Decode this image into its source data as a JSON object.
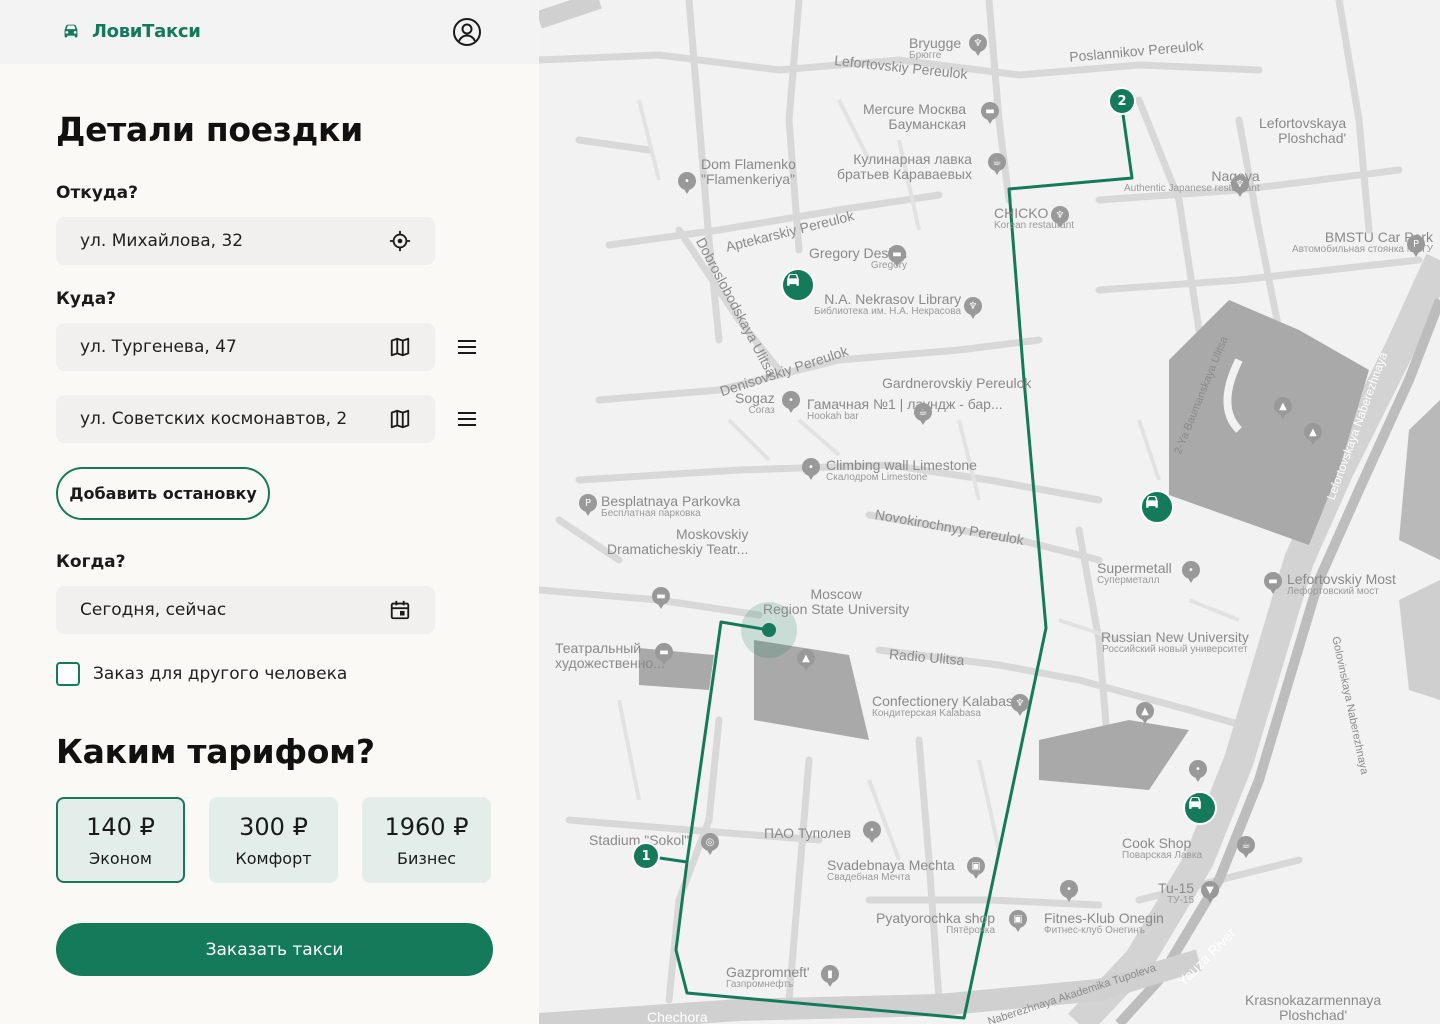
{
  "app": {
    "name": "ЛовиТакси"
  },
  "heading": "Детали поездки",
  "from": {
    "label": "Откуда?",
    "value": "ул. Михайлова, 32"
  },
  "to": {
    "label": "Куда?",
    "stops": [
      {
        "value": "ул. Тургенева, 47"
      },
      {
        "value": "ул. Советских космонавтов, 2"
      }
    ]
  },
  "add_stop_label": "Добавить остановку",
  "when": {
    "label": "Когда?",
    "value": "Сегодня, сейчас"
  },
  "other_person_label": "Заказ для другого человека",
  "tariff_heading": "Каким тарифом?",
  "tariffs": [
    {
      "price": "140 ₽",
      "name": "Эконом",
      "selected": true
    },
    {
      "price": "300 ₽",
      "name": "Комфорт",
      "selected": false
    },
    {
      "price": "1960 ₽",
      "name": "Бизнес",
      "selected": false
    }
  ],
  "order_label": "Заказать такси",
  "colors": {
    "accent": "#147a5a",
    "field_bg": "#f1f0ee",
    "tariff_bg": "#e3eeeb",
    "map_bg": "#f2f2f2"
  },
  "map": {
    "route_markers": [
      "1",
      "2"
    ],
    "labels": [
      {
        "text": "Bryugge",
        "sub": "Брюгге"
      },
      {
        "text": "Lefortovskiy Pereulok"
      },
      {
        "text": "Poslannikov Pereulok"
      },
      {
        "text": "Mercure Москва",
        "sub": "Бауманская"
      },
      {
        "text": "Dom Flamenko",
        "sub": "\"Flamenkeriya\""
      },
      {
        "text": "Кулинарная лавка",
        "sub": "братьев Караваевых"
      },
      {
        "text": "Nagoya",
        "sub": "Authentic Japanese restaurant"
      },
      {
        "text": "Lefortovskaya",
        "sub": "Ploshchad'"
      },
      {
        "text": "CHICKO",
        "sub": "Korean restaurant"
      },
      {
        "text": "Aptekarskiy Pereulok"
      },
      {
        "text": "Gregory Design",
        "sub": "Gregory"
      },
      {
        "text": "BMSTU Car Park",
        "sub": "Автомобильная стоянка МГТУ"
      },
      {
        "text": "N.A. Nekrasov Library",
        "sub": "Библиотека им. Н.А. Некрасова"
      },
      {
        "text": "Dobroslobodskaya Ulitsa"
      },
      {
        "text": "Denisovskiy Pereulok"
      },
      {
        "text": "Gardnerovskiy Pereulok"
      },
      {
        "text": "Sogaz",
        "sub": "Согаз"
      },
      {
        "text": "Гамачная №1 | лаундж - бар...",
        "sub": "Hookah bar"
      },
      {
        "text": "Climbing wall Limestone",
        "sub": "Скалодром Limestone"
      },
      {
        "text": "Besplatnaya Parkovka",
        "sub": "Бесплатная парковка"
      },
      {
        "text": "Novokirochnyy Pereulok"
      },
      {
        "text": "Moskovskiy",
        "sub": "Dramaticheskiy Teatr..."
      },
      {
        "text": "Supermetall",
        "sub": "Суперметалл"
      },
      {
        "text": "Lefortovskiy Most",
        "sub": "Лефортовский мост"
      },
      {
        "text": "Moscow",
        "sub": "Region State University"
      },
      {
        "text": "Radio Ulitsa"
      },
      {
        "text": "Театральный",
        "sub": "художественно..."
      },
      {
        "text": "Russian New University",
        "sub": "Российский новый университет"
      },
      {
        "text": "Confectionery Kalabasa",
        "sub": "Кондитерская Kalabasa"
      },
      {
        "text": "ПАО Туполев"
      },
      {
        "text": "Stadium \"Sokol\""
      },
      {
        "text": "Cook Shop",
        "sub": "Поварская Лавка"
      },
      {
        "text": "Svadebnaya Mechta",
        "sub": "Свадебная Мечта"
      },
      {
        "text": "Tu-15",
        "sub": "ТУ-15"
      },
      {
        "text": "Pyatyorochka shop",
        "sub": "Пятёрочка"
      },
      {
        "text": "Fitnes-Klub Onegin",
        "sub": "Фитнес-клуб Онегинъ"
      },
      {
        "text": "Gazpromneft'",
        "sub": "Газпромнефть"
      },
      {
        "text": "Krasnokazarmennaya",
        "sub": "Ploshchad'"
      },
      {
        "text": "Naberezhnaya Akademika Tupoleva"
      },
      {
        "text": "Yauza River"
      },
      {
        "text": "Chechora"
      },
      {
        "text": "2-Ya Baumanskaya Ulitsa"
      },
      {
        "text": "Lefortovskaya Naberezhnaya"
      },
      {
        "text": "Golovinskaya Naberezhnaya"
      }
    ]
  }
}
